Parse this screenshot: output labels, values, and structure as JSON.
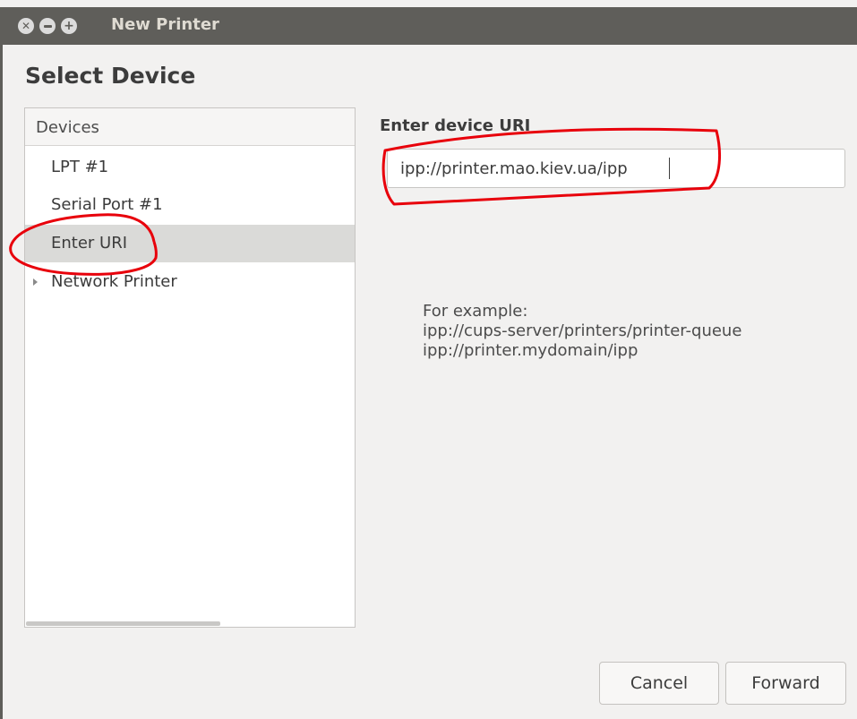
{
  "window": {
    "title": "New Printer",
    "controls": [
      "close-icon",
      "minimize-icon",
      "maximize-icon"
    ]
  },
  "page": {
    "heading": "Select Device"
  },
  "devices": {
    "header": "Devices",
    "items": [
      {
        "label": "LPT #1",
        "selected": false
      },
      {
        "label": "Serial Port #1",
        "selected": false
      },
      {
        "label": "Enter URI",
        "selected": true
      },
      {
        "label": "Network Printer",
        "selected": false,
        "expandable": true
      }
    ]
  },
  "uri": {
    "label": "Enter device URI",
    "value": "ipp://printer.mao.kiev.ua/ipp"
  },
  "example": {
    "line1": "For example:",
    "line2": "ipp://cups-server/printers/printer-queue",
    "line3": "ipp://printer.mydomain/ipp"
  },
  "buttons": {
    "cancel": "Cancel",
    "forward": "Forward"
  },
  "colors": {
    "titlebar": "#5f5e5a",
    "selected_row": "#dadad8",
    "annotation": "#e8000b"
  }
}
